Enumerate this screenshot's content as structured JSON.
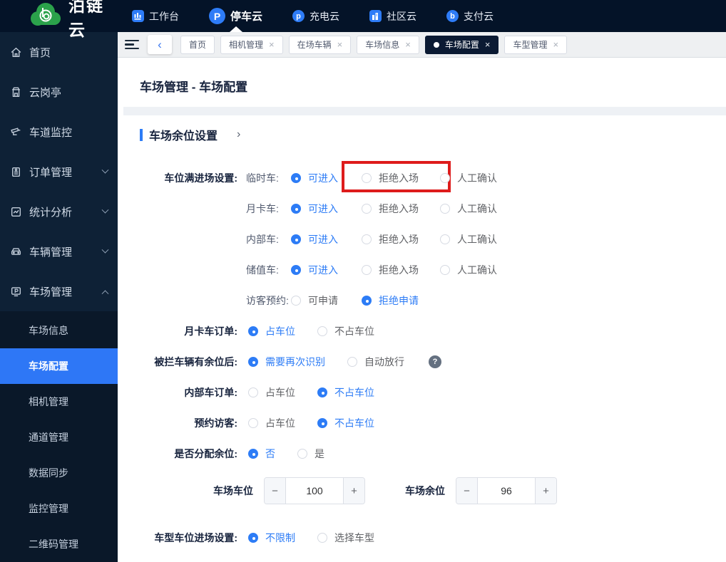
{
  "brand": {
    "name": "泊链云"
  },
  "topnav": {
    "items": [
      {
        "label": "工作台",
        "icon": "workbench-icon"
      },
      {
        "label": "停车云",
        "icon": "parking-cloud-icon"
      },
      {
        "label": "充电云",
        "icon": "charging-cloud-icon"
      },
      {
        "label": "社区云",
        "icon": "community-cloud-icon"
      },
      {
        "label": "支付云",
        "icon": "payment-cloud-icon"
      }
    ],
    "glyphs": {
      "parking": "P",
      "charging": "p",
      "payment": "b"
    }
  },
  "sidebar": {
    "items": [
      {
        "label": "首页",
        "icon": "home-icon"
      },
      {
        "label": "云岗亭",
        "icon": "booth-icon"
      },
      {
        "label": "车道监控",
        "icon": "lane-monitor-icon"
      },
      {
        "label": "订单管理",
        "icon": "order-icon"
      },
      {
        "label": "统计分析",
        "icon": "stats-icon"
      },
      {
        "label": "车辆管理",
        "icon": "vehicle-icon"
      },
      {
        "label": "车场管理",
        "icon": "parking-lot-icon"
      }
    ],
    "submenu": [
      {
        "label": "车场信息"
      },
      {
        "label": "车场配置"
      },
      {
        "label": "相机管理"
      },
      {
        "label": "通道管理"
      },
      {
        "label": "数据同步"
      },
      {
        "label": "监控管理"
      },
      {
        "label": "二维码管理"
      }
    ]
  },
  "tabs": [
    {
      "label": "首页"
    },
    {
      "label": "相机管理"
    },
    {
      "label": "在场车辆"
    },
    {
      "label": "车场信息"
    },
    {
      "label": "车场配置"
    },
    {
      "label": "车型管理"
    }
  ],
  "page": {
    "title": "车场管理 - 车场配置"
  },
  "section": {
    "title": "车场余位设置"
  },
  "form": {
    "full_entry": {
      "label": "车位满进场设置:",
      "rows": [
        {
          "sub": "临时车:",
          "opt1": "可进入",
          "opt2": "拒绝入场",
          "opt3": "人工确认"
        },
        {
          "sub": "月卡车:",
          "opt1": "可进入",
          "opt2": "拒绝入场",
          "opt3": "人工确认"
        },
        {
          "sub": "内部车:",
          "opt1": "可进入",
          "opt2": "拒绝入场",
          "opt3": "人工确认"
        },
        {
          "sub": "储值车:",
          "opt1": "可进入",
          "opt2": "拒绝入场",
          "opt3": "人工确认"
        },
        {
          "sub": "访客预约:",
          "opt1": "可申请",
          "opt2": "拒绝申请"
        }
      ]
    },
    "rows": [
      {
        "label": "月卡车订单:",
        "opt1": "占车位",
        "opt2": "不占车位"
      },
      {
        "label": "被拦车辆有余位后:",
        "opt1": "需要再次识别",
        "opt2": "自动放行"
      },
      {
        "label": "内部车订单:",
        "opt1": "占车位",
        "opt2": "不占车位"
      },
      {
        "label": "预约访客:",
        "opt1": "占车位",
        "opt2": "不占车位"
      },
      {
        "label": "是否分配余位:",
        "opt1": "否",
        "opt2": "是"
      }
    ],
    "steppers": [
      {
        "label": "车场车位",
        "value": "100",
        "minus": "−",
        "plus": "+"
      },
      {
        "label": "车场余位",
        "value": "96",
        "minus": "−",
        "plus": "+"
      }
    ],
    "vehicle_type": {
      "label": "车型车位进场设置:",
      "opt1": "不限制",
      "opt2": "选择车型"
    }
  },
  "misc": {
    "help": "?",
    "back": "‹",
    "close": "×",
    "chevron": "›"
  },
  "colors": {
    "accent_blue": "#2d7cf6",
    "topbar": "#041328",
    "sidebar": "#0e2136",
    "submenu": "#0a1829",
    "highlight_red": "#de1c1c",
    "active_tab": "#0b1a33"
  }
}
